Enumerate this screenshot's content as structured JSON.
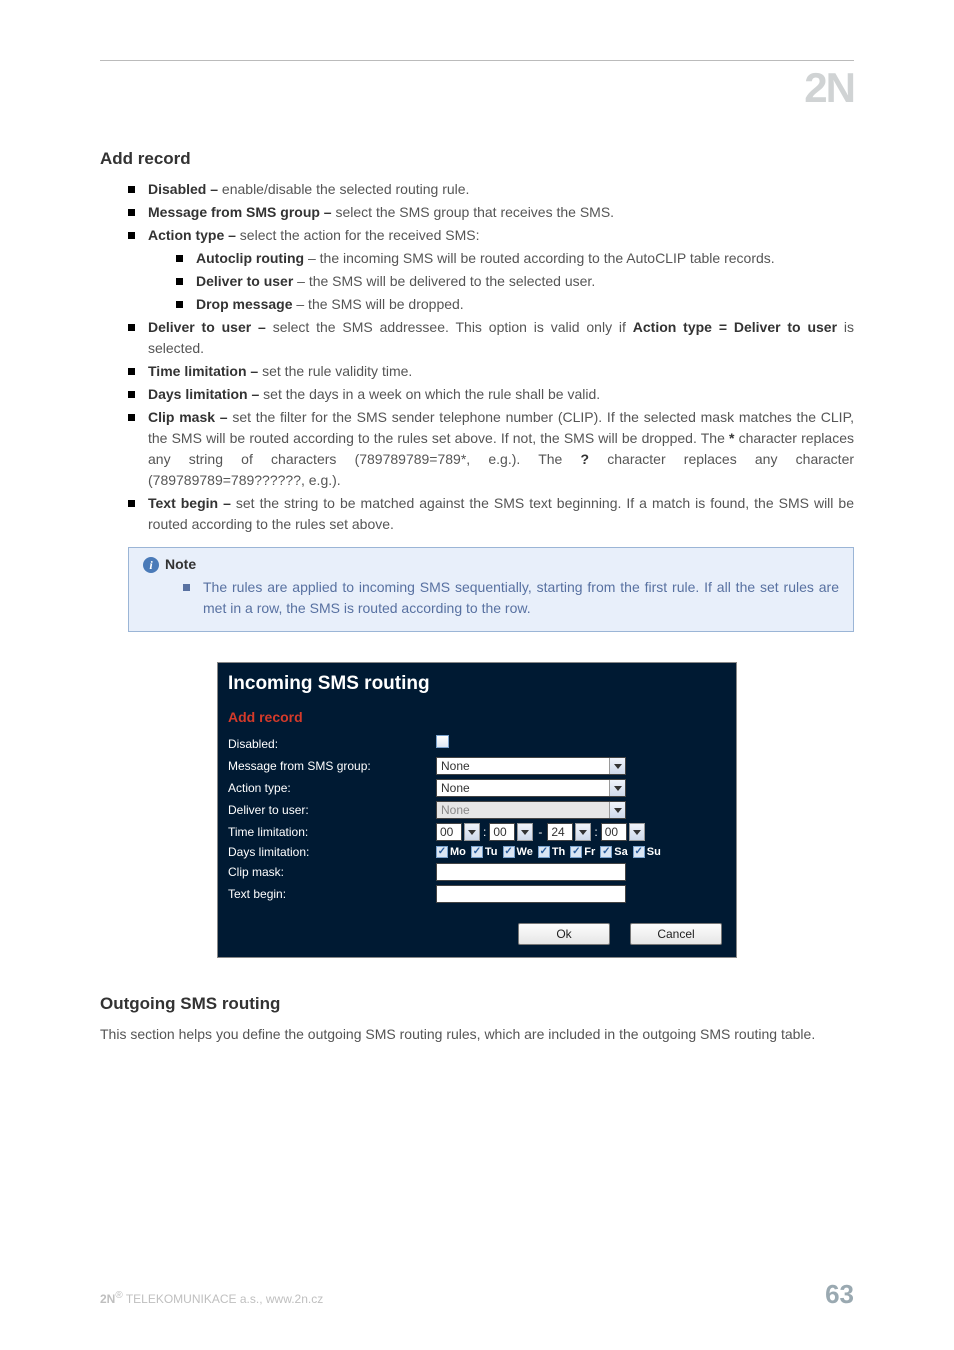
{
  "logo": "2N",
  "sections": {
    "add_record": {
      "title": "Add record",
      "items": {
        "disabled": {
          "term": "Disabled – ",
          "text": "enable/disable the selected routing rule."
        },
        "msg_group": {
          "term": "Message from SMS group – ",
          "text": "select the SMS group that receives the SMS."
        },
        "action_type": {
          "term": "Action type – ",
          "text": " select the action for the received SMS:",
          "sub": {
            "autoclip": {
              "term": "Autoclip routing",
              "text": " – the incoming SMS will be routed according to the AutoCLIP table records."
            },
            "deliver": {
              "term": "Deliver to user",
              "text": " – the SMS will be delivered to the selected user."
            },
            "drop": {
              "term": "Drop message",
              "text": " – the SMS will be dropped."
            }
          }
        },
        "deliver_user": {
          "term": "Deliver to user – ",
          "pre": "select the SMS addressee. This option is valid only if ",
          "bold": "Action type = Deliver to user",
          "post": " is selected."
        },
        "time_lim": {
          "term": "Time limitation – ",
          "text": " set the rule validity time."
        },
        "days_lim": {
          "term": "Days limitation – ",
          "text": " set the days in a week on which the rule shall be valid."
        },
        "clip_mask": {
          "term": "Clip mask – ",
          "p1": "set the filter for the SMS sender telephone number (CLIP). If the selected mask matches the CLIP, the SMS will be routed according to the rules set above. If not, the SMS will be dropped. The ",
          "star": "*",
          "p2": " character replaces any string of characters (789789789=789*, e.g.). The ",
          "q": "?",
          "p3": " character replaces any character (789789789=789??????, e.g.)."
        },
        "text_begin": {
          "term": "Text begin – ",
          "text": "set the string to be matched against the SMS text beginning. If a match is found, the SMS will be routed according to the rules set above."
        }
      }
    },
    "note": {
      "label": "Note",
      "text": "The rules are applied to incoming SMS sequentially, starting from the first rule. If all the set rules are met in a row, the SMS is routed according to the row."
    },
    "outgoing": {
      "title": "Outgoing SMS routing",
      "text": "This section helps you define the outgoing SMS routing rules, which are included in the outgoing SMS routing table."
    }
  },
  "form": {
    "title": "Incoming SMS routing",
    "subtitle": "Add record",
    "labels": {
      "disabled": "Disabled:",
      "msg_group": "Message from SMS group:",
      "action_type": "Action type:",
      "deliver_user": "Deliver to user:",
      "time_lim": "Time limitation:",
      "days_lim": "Days limitation:",
      "clip_mask": "Clip mask:",
      "text_begin": "Text begin:"
    },
    "values": {
      "msg_group": "None",
      "action_type": "None",
      "deliver_user": "None",
      "time": {
        "h1": "00",
        "m1": "00",
        "h2": "24",
        "m2": "00"
      }
    },
    "days": [
      "Mo",
      "Tu",
      "We",
      "Th",
      "Fr",
      "Sa",
      "Su"
    ],
    "buttons": {
      "ok": "Ok",
      "cancel": "Cancel"
    }
  },
  "footer": {
    "left_bold": "2N",
    "left_sup": "®",
    "left_rest": " TELEKOMUNIKACE a.s., www.2n.cz",
    "page": "63"
  }
}
